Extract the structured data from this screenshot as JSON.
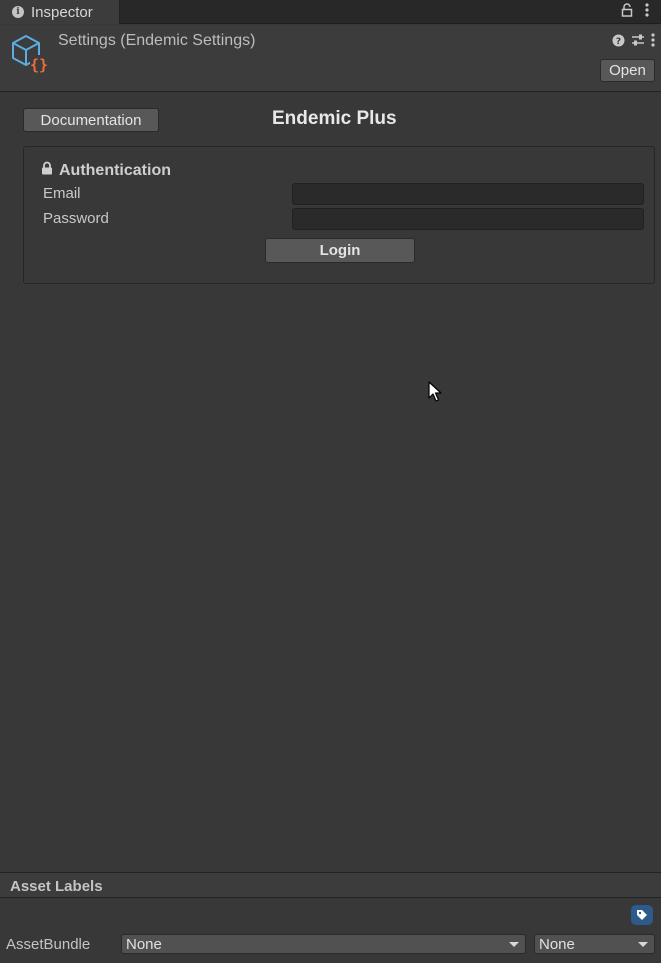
{
  "tab": {
    "label": "Inspector"
  },
  "header": {
    "title": "Settings (Endemic Settings)",
    "open_label": "Open"
  },
  "main": {
    "documentation_label": "Documentation",
    "title": "Endemic Plus"
  },
  "auth": {
    "heading": "Authentication",
    "email_label": "Email",
    "email_value": "",
    "password_label": "Password",
    "password_value": "",
    "login_label": "Login"
  },
  "footer": {
    "asset_labels_title": "Asset Labels",
    "assetbundle_label": "AssetBundle",
    "bundle_value": "None",
    "variant_value": "None"
  },
  "colors": {
    "background": "#383838",
    "tag_button": "#2d5a8a",
    "asset_icon_cube": "#5aaee0",
    "asset_icon_braces": "#f26c3a"
  }
}
